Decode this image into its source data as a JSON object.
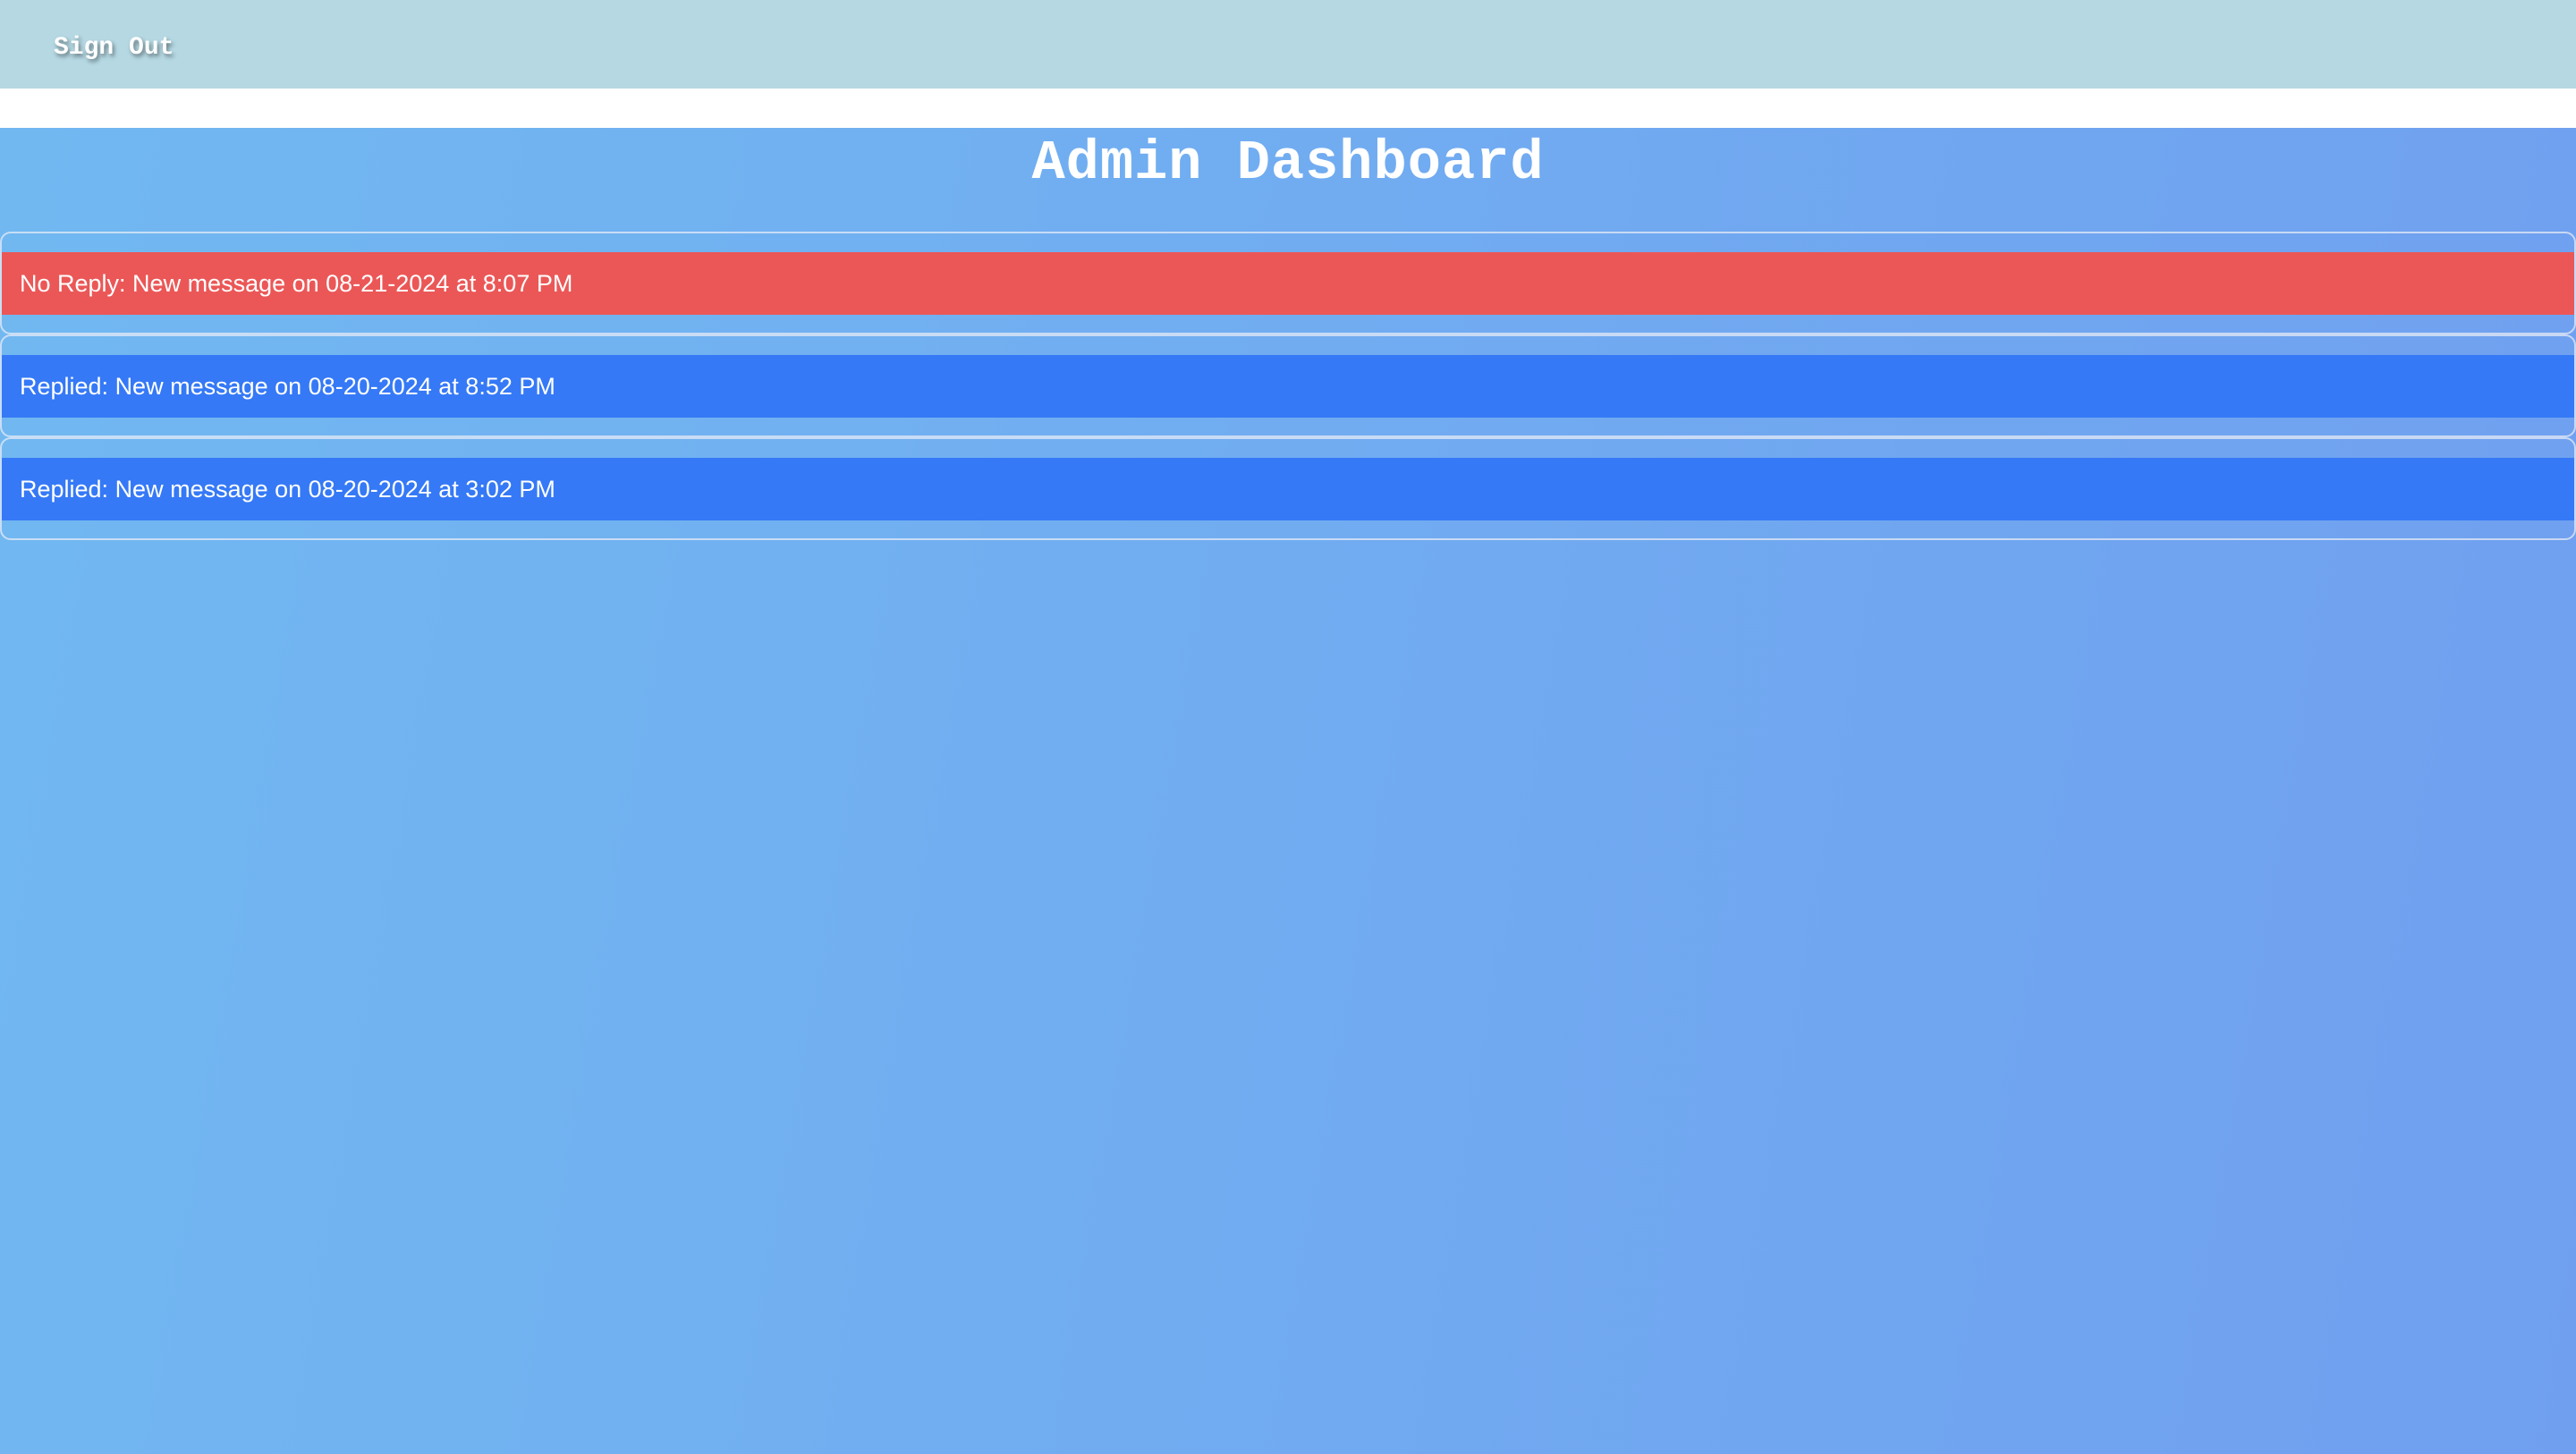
{
  "header": {
    "signout_label": "Sign Out"
  },
  "main": {
    "title": "Admin Dashboard",
    "messages": [
      {
        "label": "No Reply: New message on 08-21-2024 at 8:07 PM",
        "status": "no-reply",
        "color": "#eb5757"
      },
      {
        "label": "Replied: New message on 08-20-2024 at 8:52 PM",
        "status": "replied",
        "color": "#3579f6"
      },
      {
        "label": "Replied: New message on 08-20-2024 at 3:02 PM",
        "status": "replied",
        "color": "#3579f6"
      }
    ]
  },
  "colors": {
    "topbar": "#b5d8e3",
    "background_start": "#71b8f1",
    "background_end": "#709ff0"
  }
}
